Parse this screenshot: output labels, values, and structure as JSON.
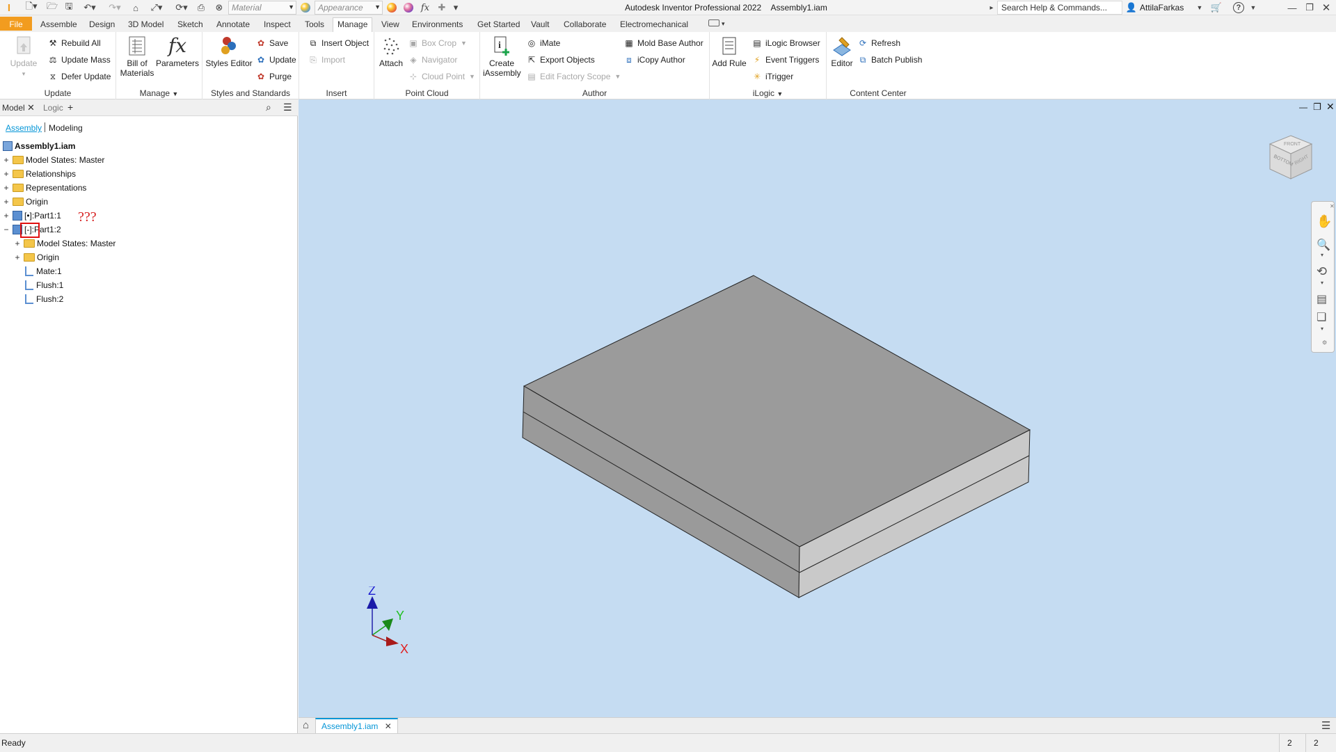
{
  "app": {
    "title": "Autodesk Inventor Professional 2022",
    "document": "Assembly1.iam",
    "search_placeholder": "Search Help & Commands...",
    "user": "AttilaFarkas"
  },
  "quick_access": {
    "material": "Material",
    "appearance": "Appearance"
  },
  "ribbon_tabs": [
    "File",
    "Assemble",
    "Design",
    "3D Model",
    "Sketch",
    "Annotate",
    "Inspect",
    "Tools",
    "Manage",
    "View",
    "Environments",
    "Get Started",
    "Vault",
    "Collaborate",
    "Electromechanical"
  ],
  "active_tab": "Manage",
  "panels": {
    "update": {
      "title": "Update",
      "update": "Update",
      "rebuild_all": "Rebuild All",
      "update_mass": "Update Mass",
      "defer_update": "Defer Update"
    },
    "manage": {
      "title": "Manage",
      "bill_of_materials_1": "Bill of",
      "bill_of_materials_2": "Materials",
      "parameters": "Parameters"
    },
    "styles": {
      "title": "Styles and Standards",
      "styles_editor": "Styles Editor",
      "save": "Save",
      "update": "Update",
      "purge": "Purge"
    },
    "insert": {
      "title": "Insert",
      "insert_object": "Insert Object",
      "import": "Import"
    },
    "point_cloud": {
      "title": "Point Cloud",
      "attach": "Attach",
      "box_crop": "Box Crop",
      "navigator": "Navigator",
      "cloud_point": "Cloud Point"
    },
    "author": {
      "title": "Author",
      "create_iassembly_1": "Create",
      "create_iassembly_2": "iAssembly",
      "imate": "iMate",
      "export_objects": "Export Objects",
      "edit_factory_scope": "Edit Factory Scope",
      "mold_base_author": "Mold Base Author",
      "icopy_author": "iCopy Author"
    },
    "ilogic": {
      "title": "iLogic",
      "add_rule": "Add Rule",
      "ilogic_browser": "iLogic Browser",
      "event_triggers": "Event Triggers",
      "itrigger": "iTrigger"
    },
    "content_center": {
      "title": "Content Center",
      "editor": "Editor",
      "refresh": "Refresh",
      "batch_publish": "Batch Publish"
    }
  },
  "browser": {
    "tab_model": "Model",
    "tab_logic": "Logic",
    "sub_assembly": "Assembly",
    "sub_modeling": "Modeling",
    "root": "Assembly1.iam",
    "items": [
      {
        "label": "Model States: Master",
        "type": "folder"
      },
      {
        "label": "Relationships",
        "type": "folder"
      },
      {
        "label": "Representations",
        "type": "folder"
      },
      {
        "label": "Origin",
        "type": "folder"
      },
      {
        "label": "[•]:Part1:1",
        "type": "part"
      },
      {
        "label": "[-]:Part1:2",
        "type": "part"
      },
      {
        "label": "Model States: Master",
        "type": "folder"
      },
      {
        "label": "Origin",
        "type": "folder"
      },
      {
        "label": "Mate:1",
        "type": "constraint"
      },
      {
        "label": "Flush:1",
        "type": "constraint"
      },
      {
        "label": "Flush:2",
        "type": "constraint"
      }
    ],
    "annotation": "???"
  },
  "axes": {
    "x": "X",
    "y": "Y",
    "z": "Z"
  },
  "viewcube": {
    "faces": [
      "FRONT",
      "BOTTOM",
      "RIGHT"
    ]
  },
  "doc_tab": "Assembly1.iam",
  "status": {
    "text": "Ready",
    "count1": "2",
    "count2": "2"
  },
  "colors": {
    "viewport_bg": "#c5dcf2",
    "file_tab": "#f29c1f",
    "accent": "#0696d7",
    "annotation_red": "#d62020"
  }
}
